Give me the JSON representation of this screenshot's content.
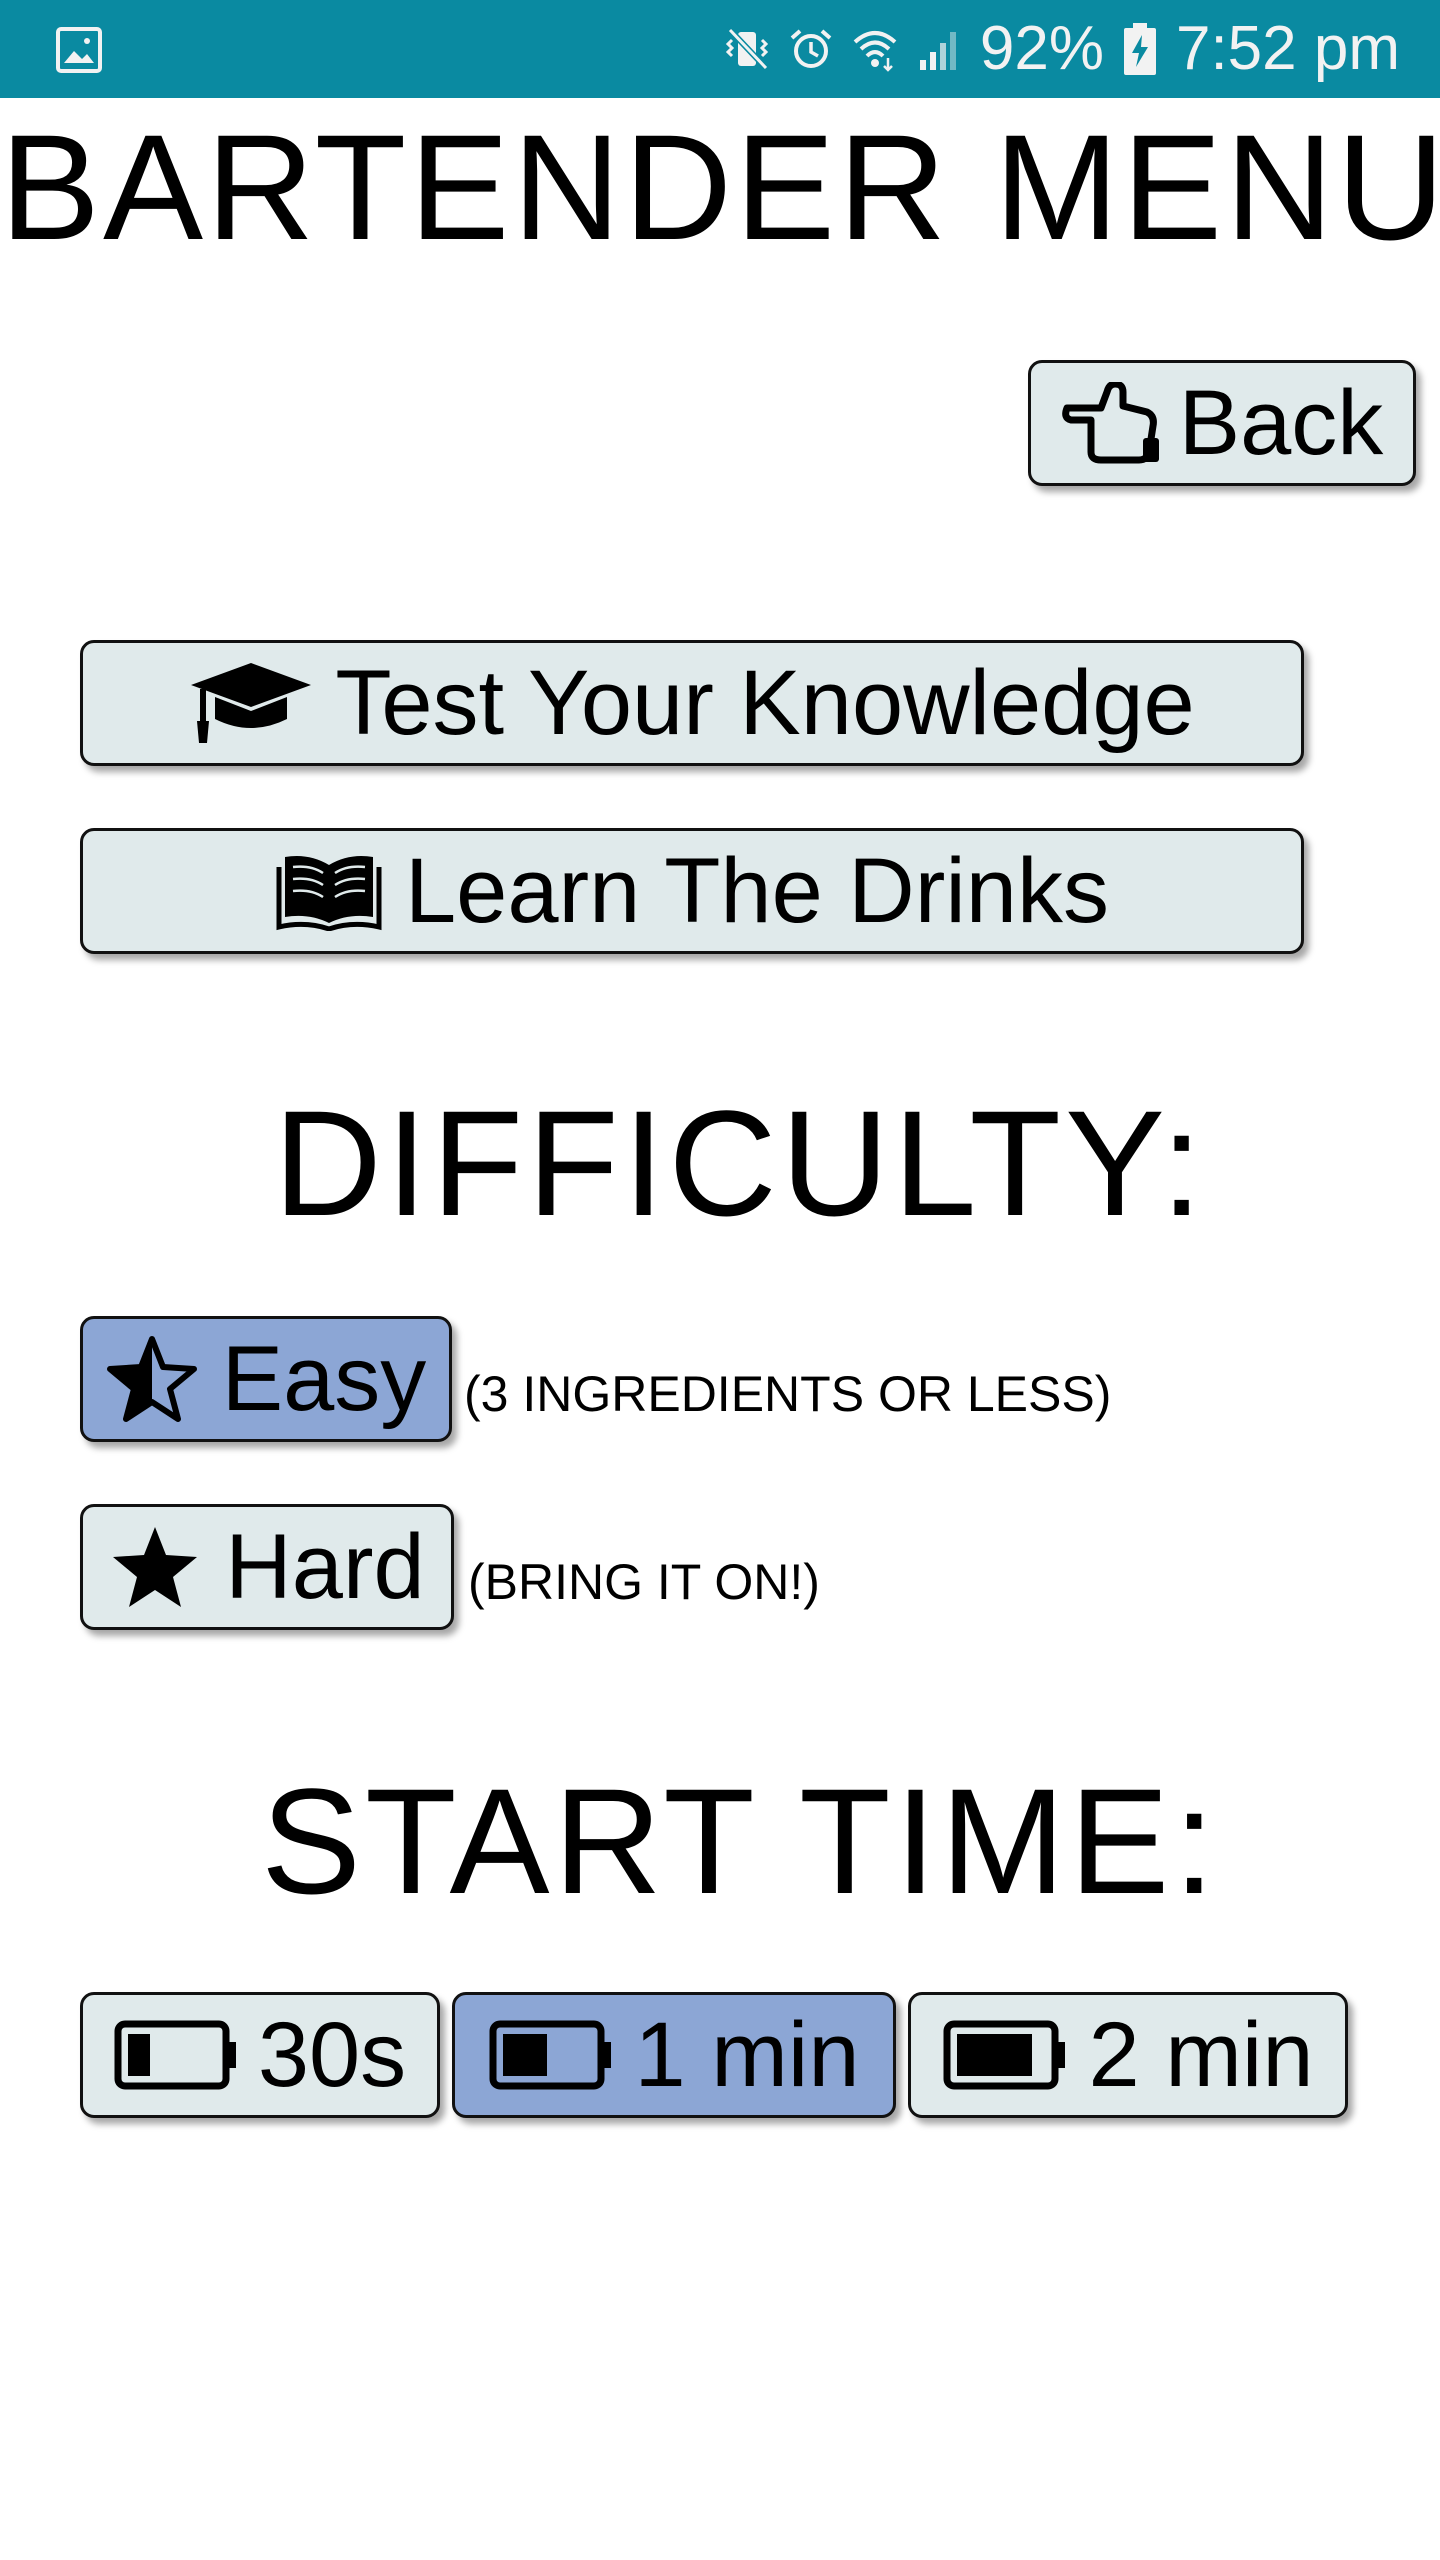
{
  "status_bar": {
    "battery_percent": "92%",
    "time": "7:52 pm",
    "icons": [
      "gallery-icon",
      "vibrate-mute-icon",
      "alarm-icon",
      "wifi-icon",
      "signal-icon",
      "battery-charging-icon"
    ],
    "background_color": "#0a8aa1"
  },
  "title": "BARTENDER MENU",
  "back_button": {
    "label": "Back",
    "icon": "hand-pointing-left-icon"
  },
  "menu": {
    "test_label": "Test Your Knowledge",
    "test_icon": "graduation-cap-icon",
    "learn_label": "Learn The Drinks",
    "learn_icon": "open-book-icon"
  },
  "difficulty": {
    "heading": "DIFFICULTY:",
    "selected": "Easy",
    "options": [
      {
        "label": "Easy",
        "note": "(3 INGREDIENTS OR LESS)",
        "icon": "half-star-icon"
      },
      {
        "label": "Hard",
        "note": "(BRING IT ON!)",
        "icon": "star-icon"
      }
    ]
  },
  "start_time": {
    "heading": "START TIME:",
    "selected": "1 min",
    "options": [
      {
        "label": "30s",
        "icon": "battery-low-icon",
        "level": 0.25
      },
      {
        "label": "1 min",
        "icon": "battery-half-icon",
        "level": 0.5
      },
      {
        "label": "2 min",
        "icon": "battery-full-icon",
        "level": 0.85
      }
    ]
  },
  "colors": {
    "button_background": "#e0eaeb",
    "selected_background": "#8ca6d5",
    "button_border": "#111111"
  }
}
